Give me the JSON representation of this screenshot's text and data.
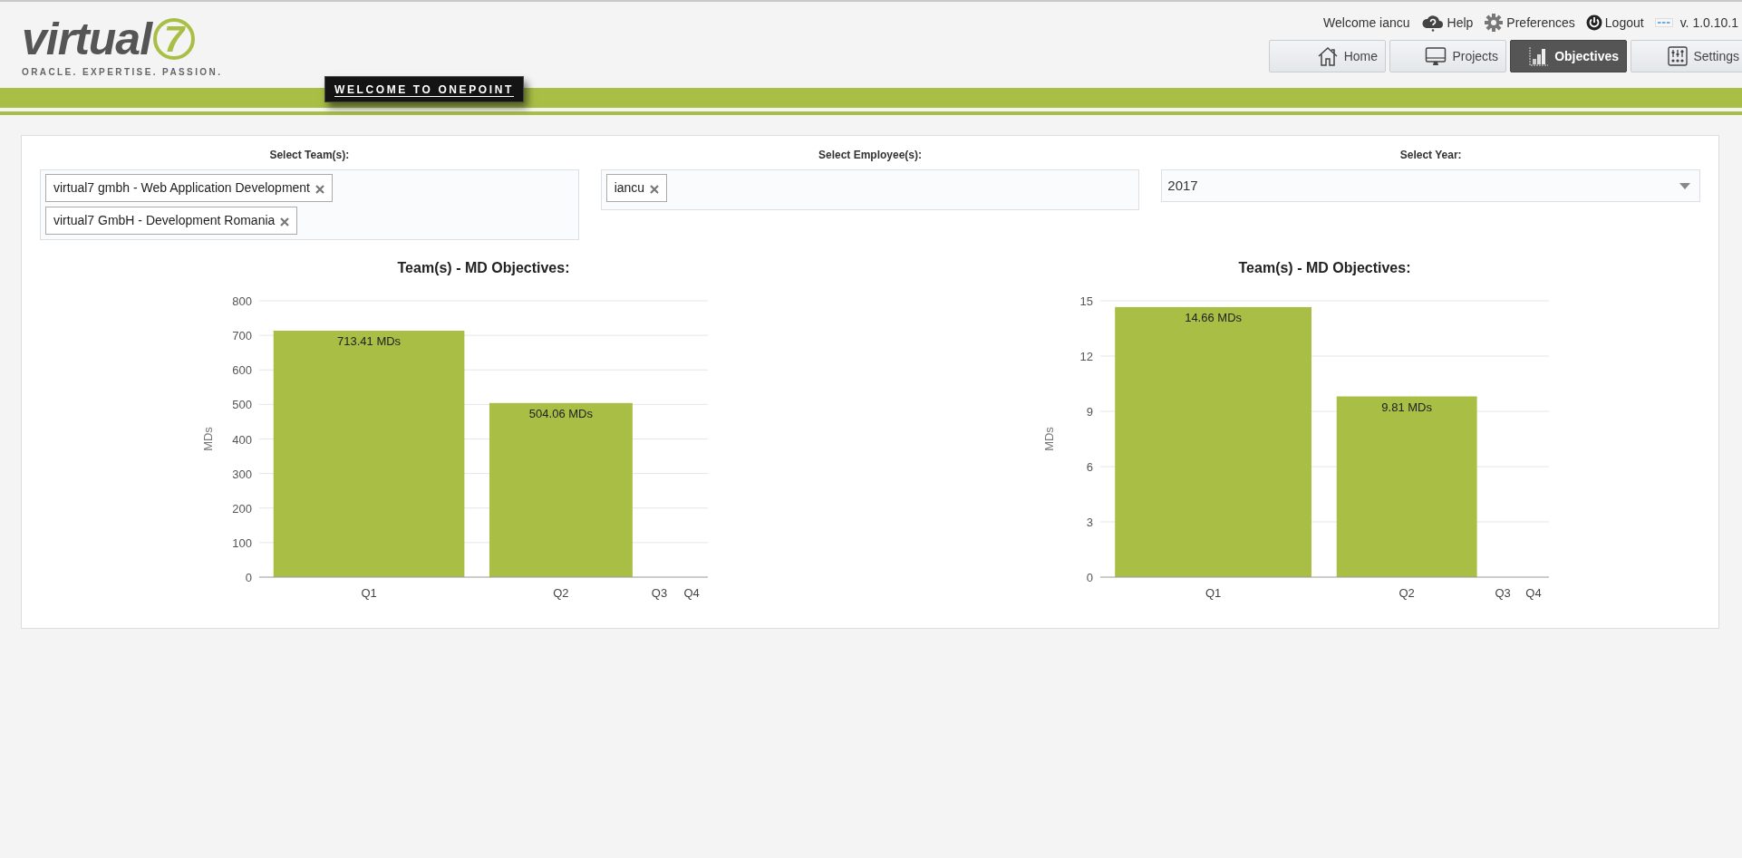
{
  "header": {
    "logo": {
      "wordmark": "virtual",
      "mark": "7",
      "tagline": "ORACLE. EXPERTISE. PASSION."
    },
    "banner": "WELCOME TO ONEPOINT",
    "welcome": "Welcome iancu",
    "links": [
      {
        "kind": "help",
        "label": "Help"
      },
      {
        "kind": "preferences",
        "label": "Preferences"
      },
      {
        "kind": "logout",
        "label": "Logout"
      }
    ],
    "version": "v. 1.0.10.1",
    "tabs": [
      {
        "kind": "home",
        "label": "Home",
        "selected": false
      },
      {
        "kind": "projects",
        "label": "Projects",
        "selected": false
      },
      {
        "kind": "objectives",
        "label": "Objectives",
        "selected": true
      },
      {
        "kind": "settings",
        "label": "Settings",
        "selected": false
      }
    ]
  },
  "filters": [
    {
      "kind": "multi",
      "label": "Select Team(s):",
      "tags": [
        "virtual7 gmbh - Web Application Development",
        "virtual7 GmbH - Development Romania"
      ]
    },
    {
      "kind": "multi",
      "label": "Select Employee(s):",
      "tags": [
        "iancu"
      ]
    },
    {
      "kind": "select",
      "label": "Select Year:",
      "value": "2017"
    }
  ],
  "charts": [
    {
      "chart_data": {
        "type": "bar",
        "title": "Team(s) - MD Objectives:",
        "ylabel": "MDs",
        "categories": [
          "Q1",
          "Q2",
          "Q3",
          "Q4"
        ],
        "series": [
          {
            "color": "#a8be45",
            "values": [
              713.41,
              504.06,
              0,
              0
            ]
          }
        ],
        "grid": true,
        "ylim": [
          0,
          800
        ],
        "yticks": [
          0,
          100,
          200,
          300,
          400,
          500,
          600,
          700,
          800
        ],
        "value_labels": [
          "713.41 MDs",
          "504.06 MDs",
          null,
          null
        ]
      }
    },
    {
      "chart_data": {
        "type": "bar",
        "title": "Team(s) - MD Objectives:",
        "ylabel": "MDs",
        "categories": [
          "Q1",
          "Q2",
          "Q3",
          "Q4"
        ],
        "series": [
          {
            "color": "#a8be45",
            "values": [
              14.66,
              9.81,
              0,
              0
            ]
          }
        ],
        "grid": true,
        "ylim": [
          0,
          15
        ],
        "yticks": [
          0,
          3,
          6,
          9,
          12,
          15
        ],
        "value_labels": [
          "14.66 MDs",
          "9.81 MDs",
          null,
          null
        ]
      }
    }
  ]
}
